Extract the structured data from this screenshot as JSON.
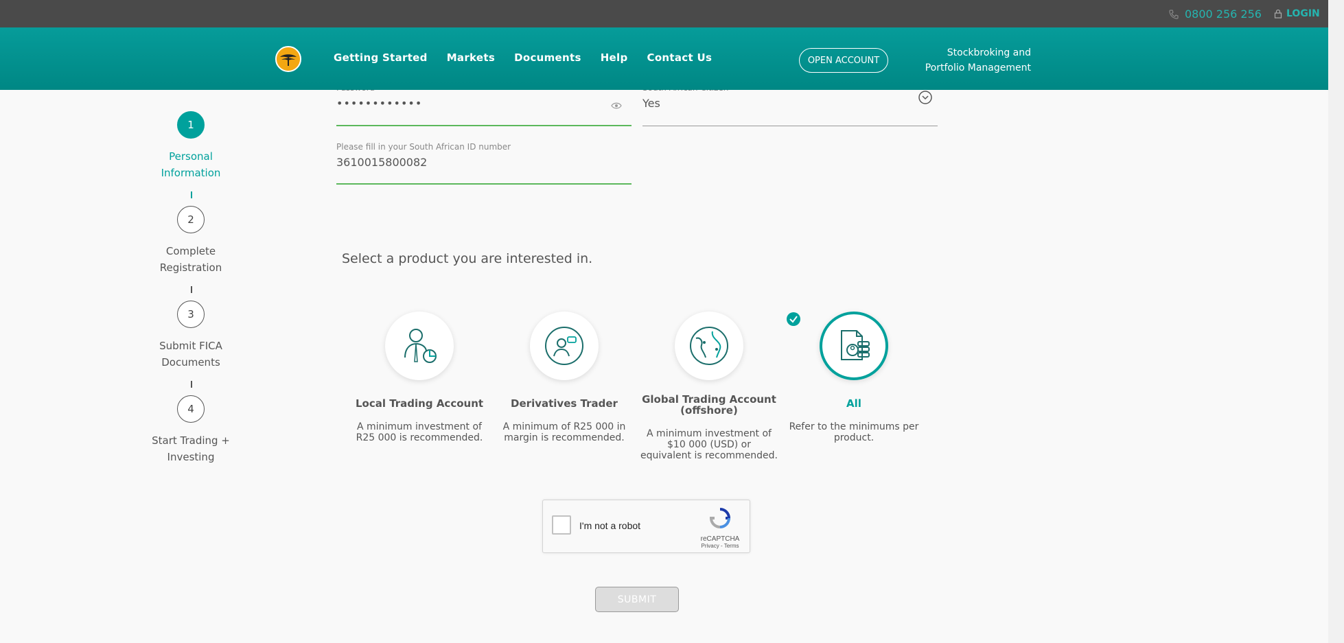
{
  "topbar": {
    "phone": "0800 256 256",
    "login": "LOGIN"
  },
  "header": {
    "nav": [
      "Getting Started",
      "Markets",
      "Documents",
      "Help",
      "Contact Us"
    ],
    "open_account": "OPEN ACCOUNT",
    "tagline_line1": "Stockbroking and",
    "tagline_line2": "Portfolio Management"
  },
  "steps": [
    {
      "number": "1",
      "line1": "Personal",
      "line2": "Information",
      "active": true
    },
    {
      "number": "2",
      "line1": "Complete",
      "line2": "Registration",
      "active": false
    },
    {
      "number": "3",
      "line1": "Submit FICA",
      "line2": "Documents",
      "active": false
    },
    {
      "number": "4",
      "line1": "Start Trading +",
      "line2": "Investing",
      "active": false
    }
  ],
  "form": {
    "password_label": "Password",
    "password_value": "••••••••••••",
    "citizen_label": "South African Citizen",
    "citizen_value": "Yes",
    "id_label": "Please fill in your South African ID number",
    "id_value": "3610015800082"
  },
  "products_heading": "Select a product you are interested in.",
  "products": [
    {
      "title": "Local Trading Account",
      "desc": "A minimum investment of R25 000 is recommended.",
      "selected": false,
      "icon": "person-chart-icon"
    },
    {
      "title": "Derivatives Trader",
      "desc": "A minimum of R25 000 in margin is recommended.",
      "selected": false,
      "icon": "trader-chat-icon"
    },
    {
      "title": "Global Trading Account (offshore)",
      "desc": "A minimum investment of $10 000 (USD) or equivalent is recommended.",
      "selected": false,
      "icon": "globe-icon"
    },
    {
      "title": "All",
      "desc": "Refer to the minimums per product.",
      "selected": true,
      "icon": "documents-coins-icon"
    }
  ],
  "captcha": {
    "label": "I'm not a robot",
    "brand": "reCAPTCHA",
    "links": "Privacy - Terms"
  },
  "submit": "SUBMIT",
  "colors": {
    "brand_teal": "#00a19c",
    "topbar": "#4a4a4a",
    "valid_green": "#5cb85c"
  }
}
